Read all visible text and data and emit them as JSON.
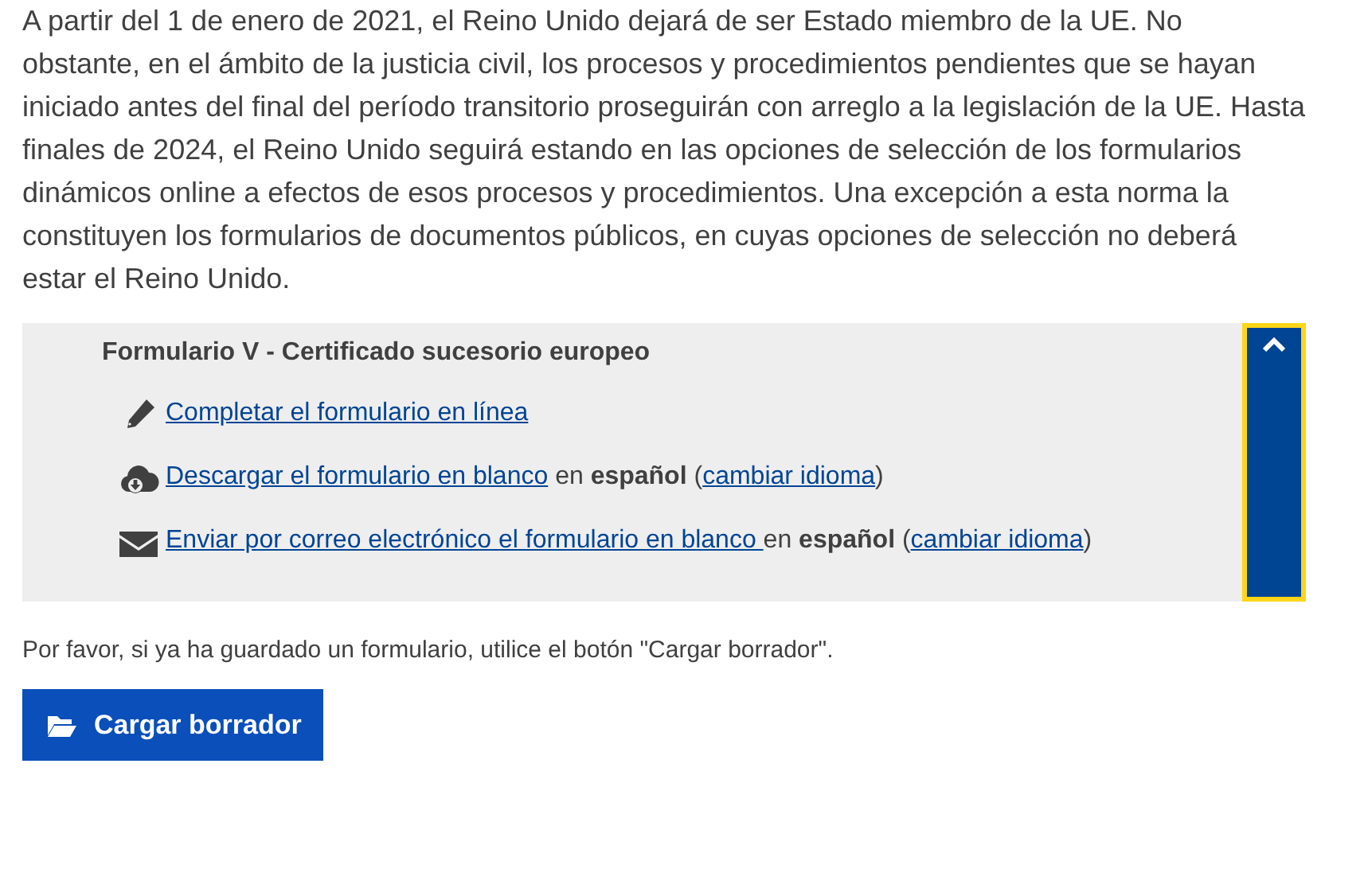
{
  "intro": "A partir del 1 de enero de 2021, el Reino Unido dejará de ser Estado miembro de la UE. No obstante, en el ámbito de la justicia civil, los procesos y procedimientos pendientes que se hayan iniciado antes del final del período transitorio proseguirán con arreglo a la legislación de la UE. Hasta finales de 2024, el Reino Unido seguirá estando en las opciones de selección de los formularios dinámicos online a efectos de esos procesos y procedimientos. Una excepción a esta norma la constituyen los formularios de documentos públicos, en cuyas opciones de selección no deberá estar el Reino Unido.",
  "panel": {
    "title": "Formulario V - Certificado sucesorio europeo",
    "expanded": true,
    "focused": true,
    "actions": [
      {
        "kind": "edit",
        "parts": [
          {
            "kind": "link",
            "text": "Completar el formulario en línea"
          }
        ]
      },
      {
        "kind": "download",
        "parts": [
          {
            "kind": "link",
            "text": "Descargar el formulario en blanco"
          },
          {
            "kind": "text",
            "text": " en **español** ("
          },
          {
            "kind": "link",
            "text": "cambiar idioma"
          },
          {
            "kind": "text",
            "text": ")"
          }
        ]
      },
      {
        "kind": "email",
        "parts": [
          {
            "kind": "link",
            "text": "Enviar por correo electrónico el formulario en blanco "
          },
          {
            "kind": "text",
            "text": "en **español** ("
          },
          {
            "kind": "link",
            "text": "cambiar idioma"
          },
          {
            "kind": "text",
            "text": ")"
          }
        ]
      }
    ]
  },
  "note": "Por favor, si ya ha guardado un formulario, utilice el botón \"Cargar borrador\".",
  "button": {
    "label": "Cargar borrador"
  }
}
